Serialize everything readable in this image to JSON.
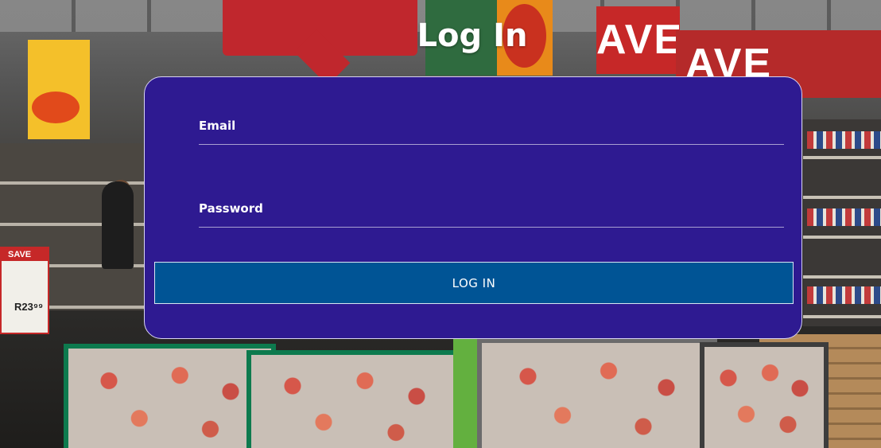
{
  "page": {
    "title": "Log In"
  },
  "form": {
    "email_label": "Email",
    "email_value": "",
    "password_label": "Password",
    "password_value": "",
    "submit_label": "LOG IN"
  },
  "background": {
    "signs": [
      "SAVE",
      "AVE",
      "AVE"
    ],
    "price_card_header": "SAVE",
    "price_card_price": "R23⁹⁹"
  },
  "colors": {
    "card_background": "#2e1a91",
    "button_background": "#005495",
    "text": "#ffffff"
  }
}
